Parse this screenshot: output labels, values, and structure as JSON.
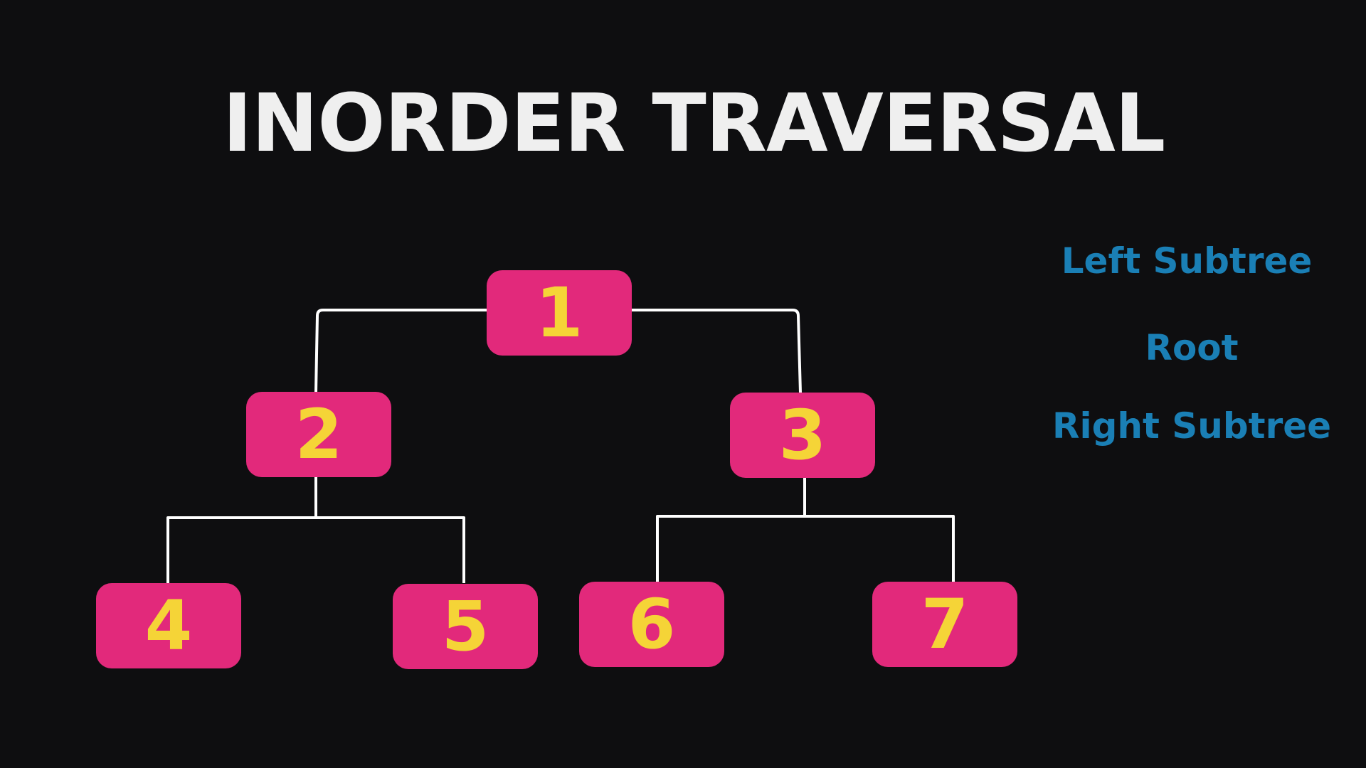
{
  "title": "INORDER TRAVERSAL",
  "nodes": {
    "n1": "1",
    "n2": "2",
    "n3": "3",
    "n4": "4",
    "n5": "5",
    "n6": "6",
    "n7": "7"
  },
  "legend": {
    "left": "Left Subtree",
    "root": "Root",
    "right": "Right Subtree"
  },
  "colors": {
    "background": "#0e0e10",
    "node_fill": "#e2297b",
    "node_text": "#f5d437",
    "legend_text": "#1a7fb5",
    "title_text": "#efefef",
    "edge": "#ffffff"
  }
}
